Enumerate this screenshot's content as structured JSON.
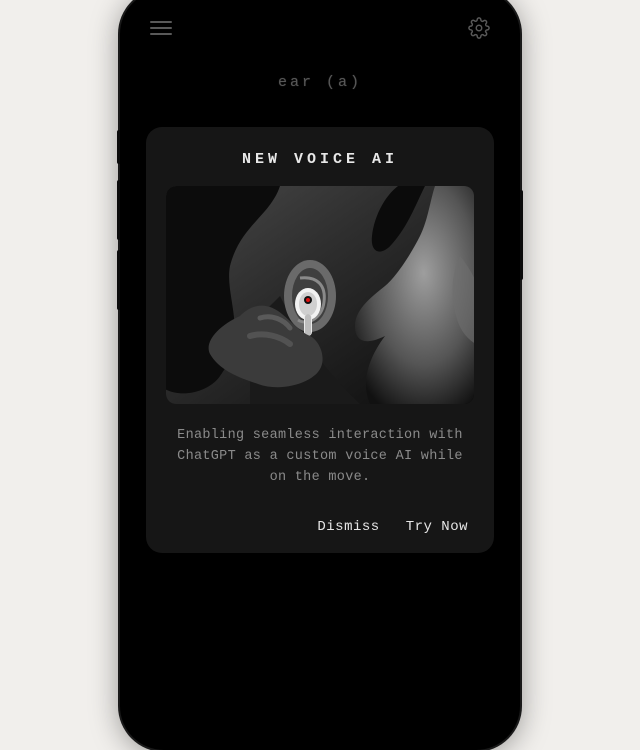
{
  "header": {
    "menu_label": "Menu",
    "settings_label": "Settings"
  },
  "device": {
    "name": "ear (a)"
  },
  "card": {
    "title": "NEW VOICE AI",
    "body": "Enabling seamless interaction with ChatGPT as a custom voice AI while on the move.",
    "dismiss_label": "Dismiss",
    "try_label": "Try Now"
  },
  "icons": {
    "menu": "menu-icon",
    "gear": "gear-icon"
  }
}
